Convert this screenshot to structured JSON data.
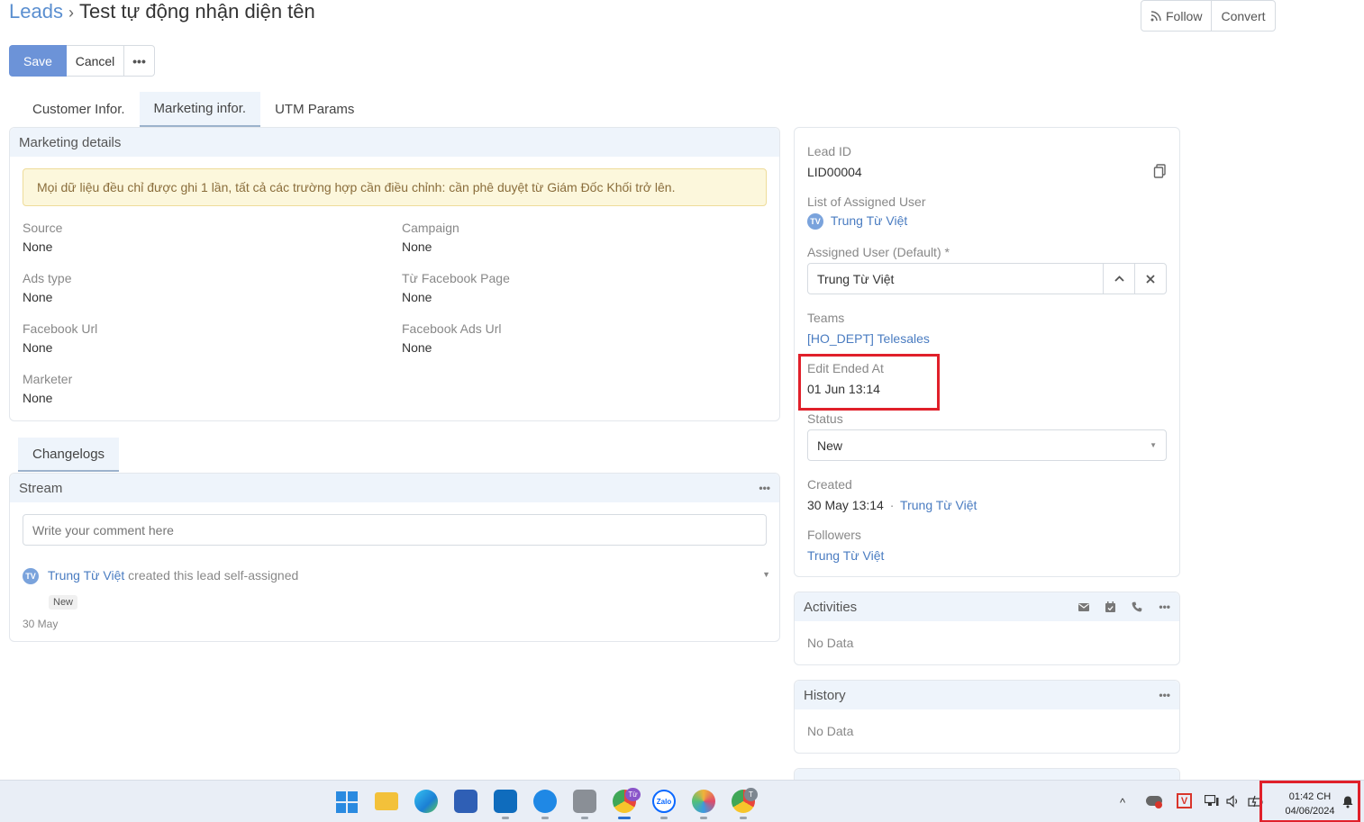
{
  "breadcrumb": {
    "root": "Leads",
    "separator": "›",
    "title": "Test tự động nhận diện tên"
  },
  "header": {
    "follow_label": "Follow",
    "convert_label": "Convert"
  },
  "actions": {
    "save_label": "Save",
    "cancel_label": "Cancel",
    "more_label": "•••"
  },
  "tabs": [
    {
      "label": "Customer Infor."
    },
    {
      "label": "Marketing infor."
    },
    {
      "label": "UTM Params"
    }
  ],
  "marketing": {
    "title": "Marketing details",
    "notice": "Mọi dữ liệu đều chỉ được ghi 1 lần, tất cả các trường hợp cần điều chỉnh: cần phê duyệt từ Giám Đốc Khối trở lên.",
    "fields": [
      {
        "label": "Source",
        "value": "None"
      },
      {
        "label": "Campaign",
        "value": "None"
      },
      {
        "label": "Ads type",
        "value": "None"
      },
      {
        "label": "Từ Facebook Page",
        "value": "None"
      },
      {
        "label": "Facebook Url",
        "value": "None"
      },
      {
        "label": "Facebook Ads Url",
        "value": "None"
      },
      {
        "label": "Marketer",
        "value": "None"
      }
    ]
  },
  "changelogs": {
    "tab_label": "Changelogs",
    "stream_title": "Stream",
    "more_label": "•••",
    "comment_placeholder": "Write your comment here",
    "entry": {
      "avatar": "TV",
      "user": "Trung Từ Việt",
      "action": " created this lead self-assigned",
      "badge": "New",
      "date": "30 May"
    }
  },
  "side": {
    "lead_id_label": "Lead ID",
    "lead_id": "LID00004",
    "assigned_list_label": "List of Assigned User",
    "assigned_avatar": "TV",
    "assigned_user": "Trung Từ Việt",
    "assigned_default_label": "Assigned User (Default) *",
    "assigned_default_value": "Trung Từ Việt",
    "teams_label": "Teams",
    "teams_value": "[HO_DEPT] Telesales",
    "edit_ended_label": "Edit Ended At",
    "edit_ended_value": "01 Jun 13:14",
    "status_label": "Status",
    "status_value": "New",
    "created_label": "Created",
    "created_date": "30 May 13:14",
    "created_sep": "·",
    "created_by": "Trung Từ Việt",
    "followers_label": "Followers",
    "followers_value": "Trung Từ Việt"
  },
  "activities": {
    "title": "Activities",
    "empty": "No Data",
    "more_label": "•••"
  },
  "history": {
    "title": "History",
    "empty": "No Data",
    "more_label": "•••"
  },
  "taskbar": {
    "chrome_badge": "Từ",
    "zalo_label": "Zalo",
    "profile_badge": "T",
    "tray_chevron": "^",
    "clock_time": "01:42 CH",
    "clock_date": "04/06/2024"
  },
  "colors": {
    "accent": "#6c93d8",
    "link": "#4a7cc1",
    "highlight": "#e0202a",
    "notice_bg": "#fcf7dc"
  }
}
